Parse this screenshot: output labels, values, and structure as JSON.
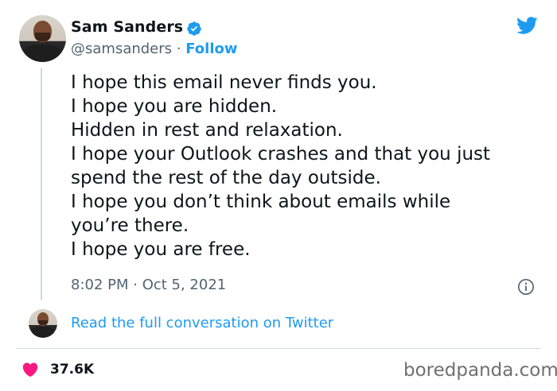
{
  "author": {
    "name": "Sam Sanders",
    "handle": "@samsanders",
    "separator": " · ",
    "follow_label": "Follow"
  },
  "tweet": {
    "lines": [
      "I hope this email never finds you.",
      "I hope you are hidden.",
      "Hidden in rest and relaxation.",
      "I hope your Outlook crashes and that you just",
      "spend the rest of the day outside.",
      "I hope you don’t think about emails while",
      "you’re there.",
      "I hope you are free."
    ],
    "timestamp": "8:02 PM · Oct 5, 2021"
  },
  "conversation_link": "Read the full conversation on Twitter",
  "likes": "37.6K",
  "watermark": "boredpanda.com",
  "colors": {
    "accent": "#1d9bf0",
    "heart": "#f91880",
    "secondary_text": "#536471",
    "divider": "#cfd9de"
  },
  "icons": [
    "verified-badge-icon",
    "twitter-bird-icon",
    "info-icon",
    "heart-icon"
  ]
}
